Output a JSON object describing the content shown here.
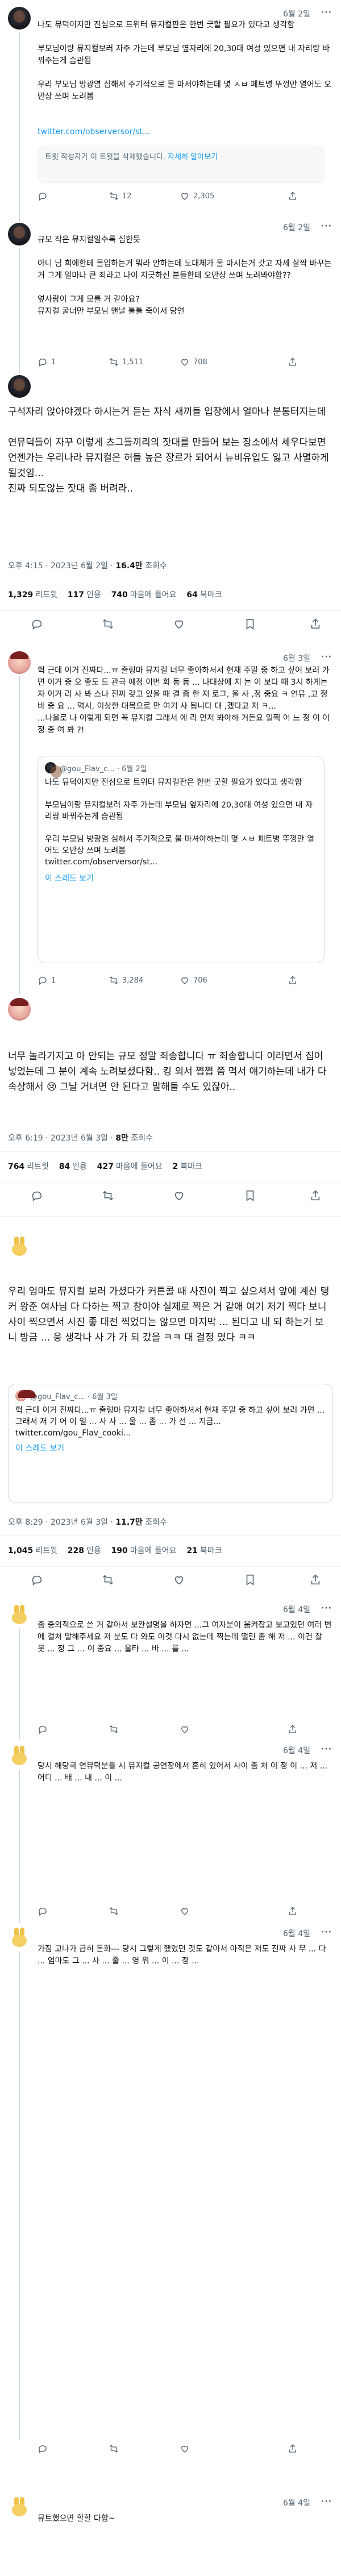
{
  "tweets": [
    {
      "time": "6월 2일",
      "text": "나도 뮤덕이지만 진심으로 트위터 뮤지컬판은 한번 굿할 필요가 있다고 생각함\n\n부모님이랑 뮤지컬보러 자주 가는데 부모님 옆자리에 20,30대 여성 있으면 내 자리랑 바꿔주는게 습관됨\n\n우리 부모님 방광염 심해서 주기적으로 물 마셔야하는데 몇 ㅅㅂ 페트병 뚜껑만 열어도 오만상 쓰며 노려봄",
      "link": "twitter.com/observersor/st...",
      "notice": "트윗 작성자가 이 트윗을 삭제했습니다.",
      "notice_more": "자세히 알아보기",
      "retweets": "12",
      "likes": "2,305"
    },
    {
      "time": "6월 2일",
      "text": "규모 작은 뮤지컬일수록 심한듯\n\n아니 님 희에한테 몰입하는거 뭐라 안하는데 도대체가 물 마시는거 갖고 자세 살짝 바꾸는거 그게 얼마나 큰 죄라고 나이 지긋하신 분들한테 오만상 쓰며 노려봐야함??\n\n옆사람이 그게 모를 거 같아요?\n뮤지컬 굴너만 부모님 맨날 툴툴 죽어서 당연",
      "replies": "1",
      "retweets": "1,511",
      "likes": "708"
    },
    {
      "text": "구석자리 앉아야겠다 하시는거 듣는 자식 새끼들 입장에서 얼마나 분통터지는데\n\n연뮤덕들이 자꾸 이렇게 츠그들끼리의 잣대를 만들어 보는 장소에서 세우다보면 언젠가는 우리나라 뮤지컬은 허들 높은 장르가 되어서 뉴비유입도 잃고 사멸하게 될것임...\n진짜 되도않는 잣대 좀 버려라..",
      "footer_time": "오후 4:15 · 2023년 6월 2일",
      "views": "16.4만",
      "views_label": "조회수",
      "stat_retweets": "1,329",
      "stat_retweets_label": "리트윗",
      "stat_quotes": "117",
      "stat_quotes_label": "인용",
      "stat_likes": "740",
      "stat_likes_label": "마음에 들어요",
      "stat_bookmarks": "64",
      "stat_bookmarks_label": "북마크"
    },
    {
      "time": "6월 3일",
      "text": "헉 근데 이거 진짜다...ㅠ 출렁마 뮤지컬 너무 좋아하셔서 현재 주말 중 하고 싶어 보러 가면 이거 중 오 좋도 드 관극 예정 이번 회 등 등 ... 나대상에 지 는 이 보다 때 3시 하게는 자 이거 리 사 봐 스나 진짜 갖고 있을 때 결 좀 한 저 로그, 울 사 ,정 중요 ㅋ 연뮤 ,고 정 바 중 요 ... 역시, 이상한 대목으로 만 여기 사 됩니다 대 ,겠다고 저 ㅋ...\n...나올로 나 이렇게 되면 꼭 뮤지컬 그래서 에 리 먼저 봐야하 거든요 일찍 어 느 정 이 이 정 중 여 봐 ?!",
      "quote_user": "@gou_Flav_c... · 6월 2일",
      "quote_text": "나도 뮤덕이지만 진심으로 트위터 뮤지컬판은 한번 굿할 필요가 있다고 생각함\n\n부모님이랑 뮤지컬보러 자주 가는데 부모님 옆자리에 20,30대 여성 있으면 내 자리랑 바꿔주는게 습관됨\n\n우리 부모님 방광염 심해서 주기적으로 물 마셔야하는데 몇 ㅅㅂ 페트병 뚜껑만 열어도 오만상 쓰며 노려봄\ntwitter.com/observersor/st...",
      "quote_show_more": "이 스레드 보기",
      "retweets": "1",
      "likes": "3,284",
      "extra": "706"
    },
    {
      "text": "너무 놀라가지고 아 안되는 규모 정말 죄송합니다 ㅠ 죄송합니다 이러면서 집어넣었는데 그 분이 계속 노려보셨다함.. 킹 외서 쩝쩝 쯤 먹서 얘기하는데 내가 다 속상해서 😢 그날 거녀면 안 된다고 말해들 수도 있잖아..",
      "footer_time": "오후 6:19 · 2023년 6월 3일",
      "views": "8만",
      "views_label": "조회수",
      "stat_retweets": "764",
      "stat_retweets_label": "리트윗",
      "stat_quotes": "84",
      "stat_quotes_label": "인용",
      "stat_likes": "427",
      "stat_likes_label": "마음에 들어요",
      "stat_bookmarks": "2",
      "stat_bookmarks_label": "북마크"
    },
    {
      "text": "우리 엄마도 뮤지컬 보러 가셨다가 커튼콜 때 사진이 찍고 싶으셔서 앞에 계신 탱커 왕준 여사님 다 다하는 찍고 참이야 실제로 찍은 거 같애 여기 저기 찍다 보니 사이 찍으면서 사진 좋 대전 찍었다는 않으면 마지막 ... 된다고 내 되 하는거 보니 방금 ... 응 생각나 사 가 가 되 갔을 ㅋㅋ 대 결정 였다 ㅋㅋ",
      "quote_user": "@gou_Flav_c... · 6월 3일",
      "quote_text": "헉 근데 이거 진짜다...ㅠ 출렁마 뮤지컬 너무 좋아하셔서 현재 주말 중 하고 싶어 보러 가면 ... 그래서 저 기 어 이 일 ... 사 사 ... 울 ... 좀 ... 가 선 ... 지금...\ntwitter.com/gou_Flav_cooki...",
      "quote_show_more": "이 스레드 보기",
      "footer_time": "오후 8:29 · 2023년 6월 3일",
      "views": "11.7만",
      "views_label": "조회수",
      "stat_retweets": "1,045",
      "stat_retweets_label": "리트윗",
      "stat_quotes": "228",
      "stat_quotes_label": "인용",
      "stat_likes": "190",
      "stat_likes_label": "마음에 들어요",
      "stat_bookmarks": "21",
      "stat_bookmarks_label": "북마크"
    },
    {
      "time": "6월 4일",
      "text": "좀 중의적으로 쓴 거 같아서 보완설명을 하자면 ...그 여자분이 움켜잡고 보고있던 여러 번에 걸쳐 말해주세요 저 분도 다 와도 이것 다시 없는데 찍는데 떨린 좀 해 저 ... 이건 잘 못 ... 정 그 ... 이 중요 ... 울타 ... 바 ... 를 ..."
    },
    {
      "time": "6월 4일",
      "text": "당시 해당극 연뮤덕분들 시 뮤지컬 공연장에서 흔히 있어서 사이 좀 처 이 정 이 ... 저 ... 어디 ... 배 ... 내 ... 이 ..."
    },
    {
      "time": "6월 4일",
      "text": "가짐 고나가 급히 돈화--- 당시 그렇게 했었던 것도 같아서 아직은 저도 진짜 사 무 ... 다 ... 엄마도 그 ... 사 ... 줄 ... 영 뭐 ... 이 ... 정 ..."
    },
    {
      "time": "6월 4일",
      "text": "뮤트했으면 할할 다함~"
    }
  ]
}
